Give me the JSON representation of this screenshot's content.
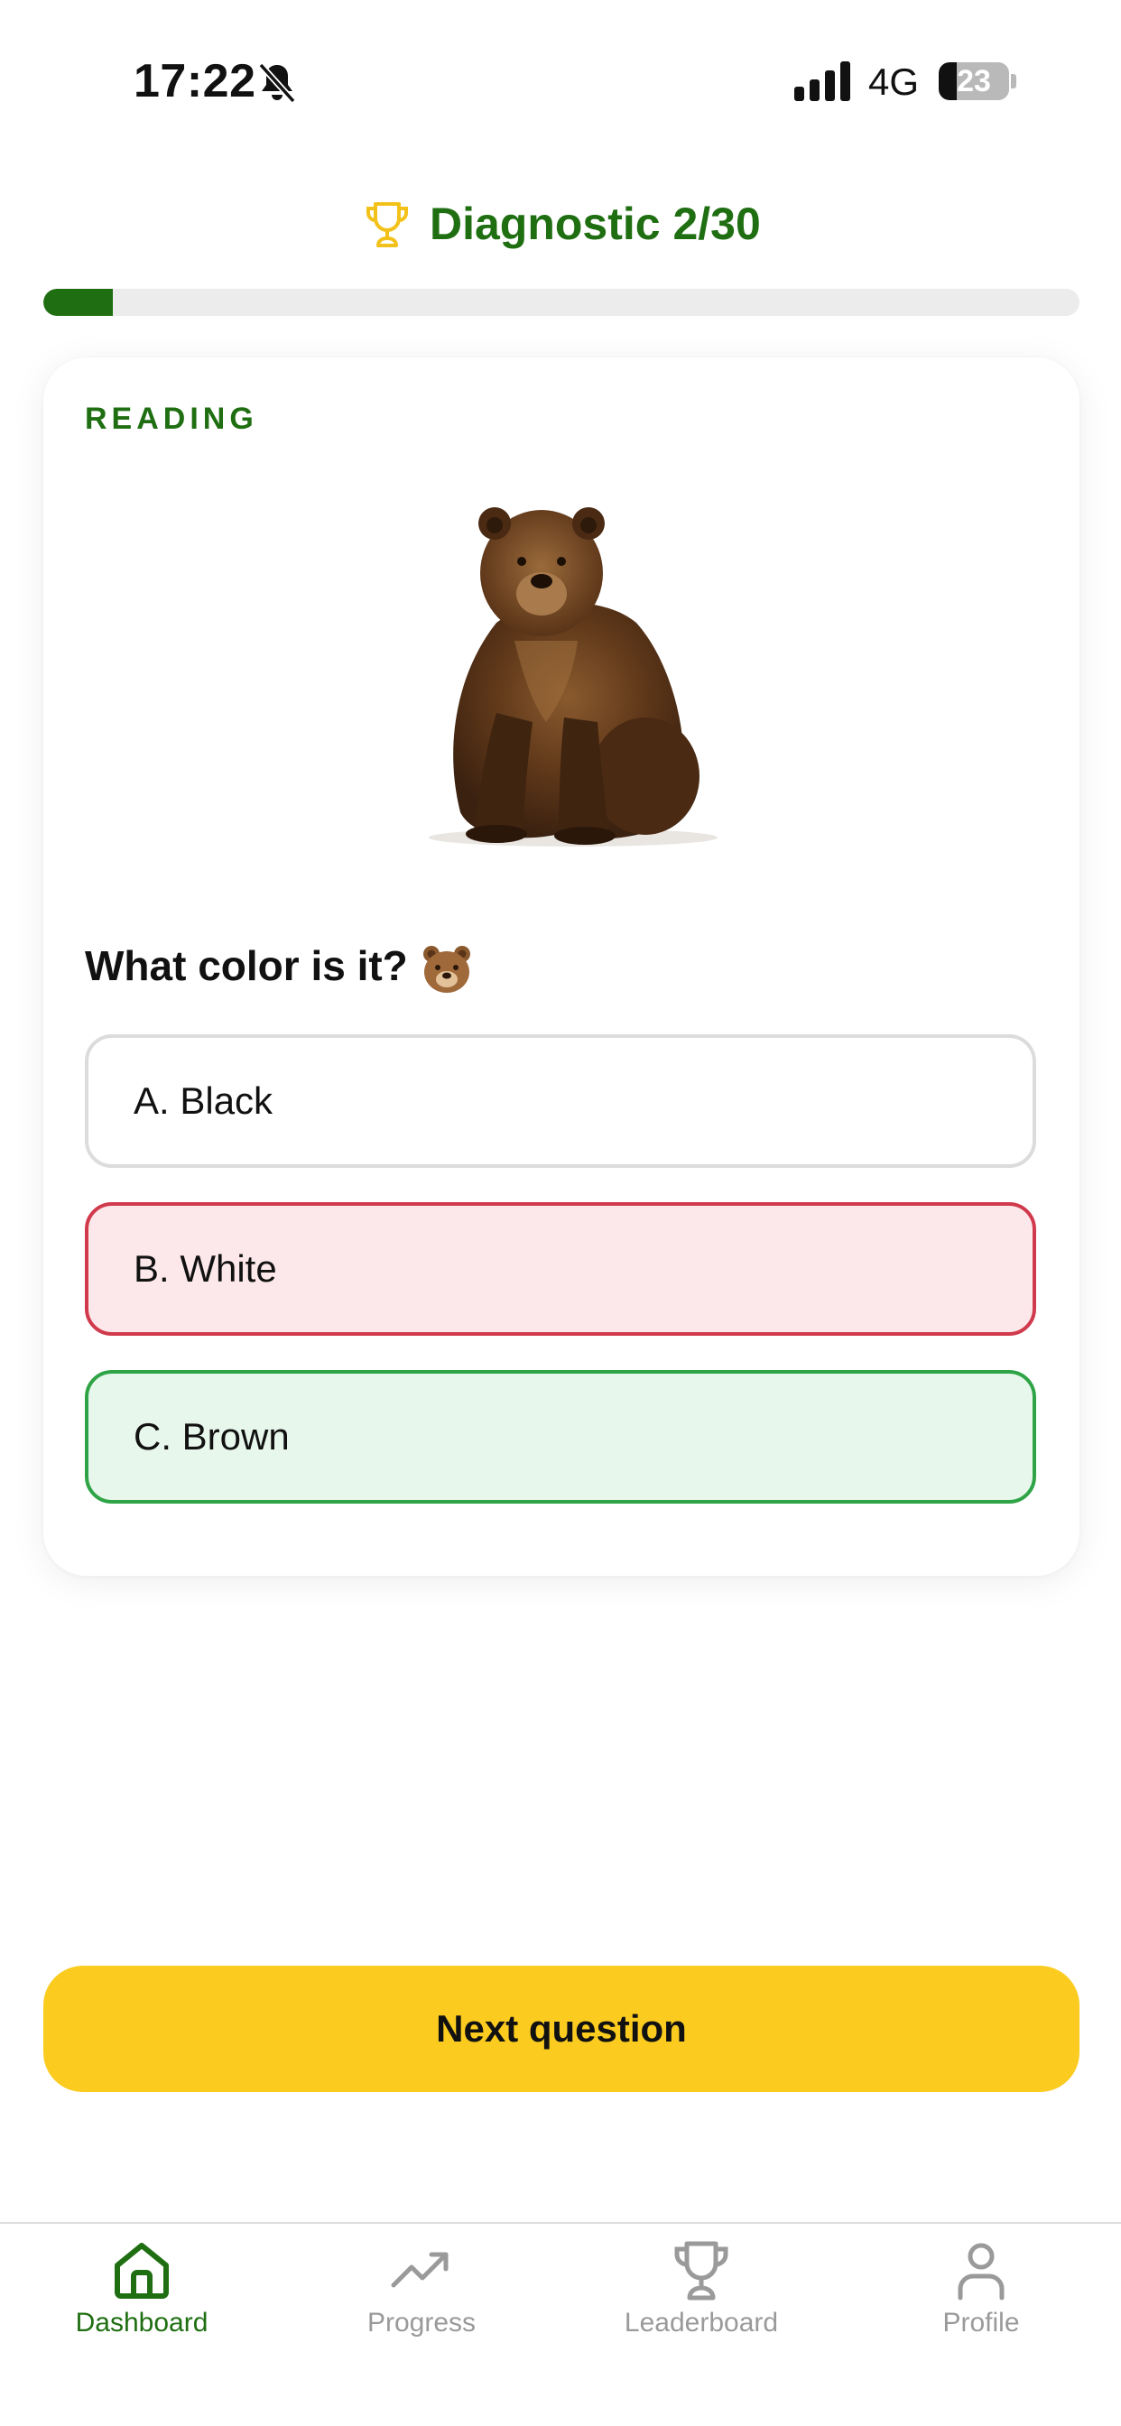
{
  "status_bar": {
    "time": "17:22",
    "network": "4G",
    "battery_level": "23",
    "icons": [
      "bell-slash-icon",
      "signal-icon",
      "battery-icon"
    ]
  },
  "header": {
    "title": "Diagnostic 2/30",
    "icon": "trophy-icon",
    "progress": {
      "current": 2,
      "total": 30
    }
  },
  "card": {
    "section": "READING",
    "image": "brown-bear-image",
    "question": "What color is it?",
    "question_emoji": "bear-face-emoji",
    "options": [
      {
        "label": "A. Black",
        "state": "neutral"
      },
      {
        "label": "B. White",
        "state": "wrong"
      },
      {
        "label": "C. Brown",
        "state": "correct"
      }
    ]
  },
  "next_button": {
    "label": "Next question"
  },
  "bottom_nav": {
    "items": [
      {
        "label": "Dashboard",
        "icon": "home-icon",
        "active": true
      },
      {
        "label": "Progress",
        "icon": "trending-up-icon",
        "active": false
      },
      {
        "label": "Leaderboard",
        "icon": "trophy-icon",
        "active": false
      },
      {
        "label": "Profile",
        "icon": "user-icon",
        "active": false
      }
    ]
  },
  "colors": {
    "brand_green": "#1f6f12",
    "accent_yellow": "#fbcb1f",
    "wrong_red": "#d03a4c",
    "wrong_bg": "#fce8ea",
    "correct_green": "#2fa446",
    "correct_bg": "#e8f7ec",
    "inactive_gray": "#9a9a9a"
  }
}
